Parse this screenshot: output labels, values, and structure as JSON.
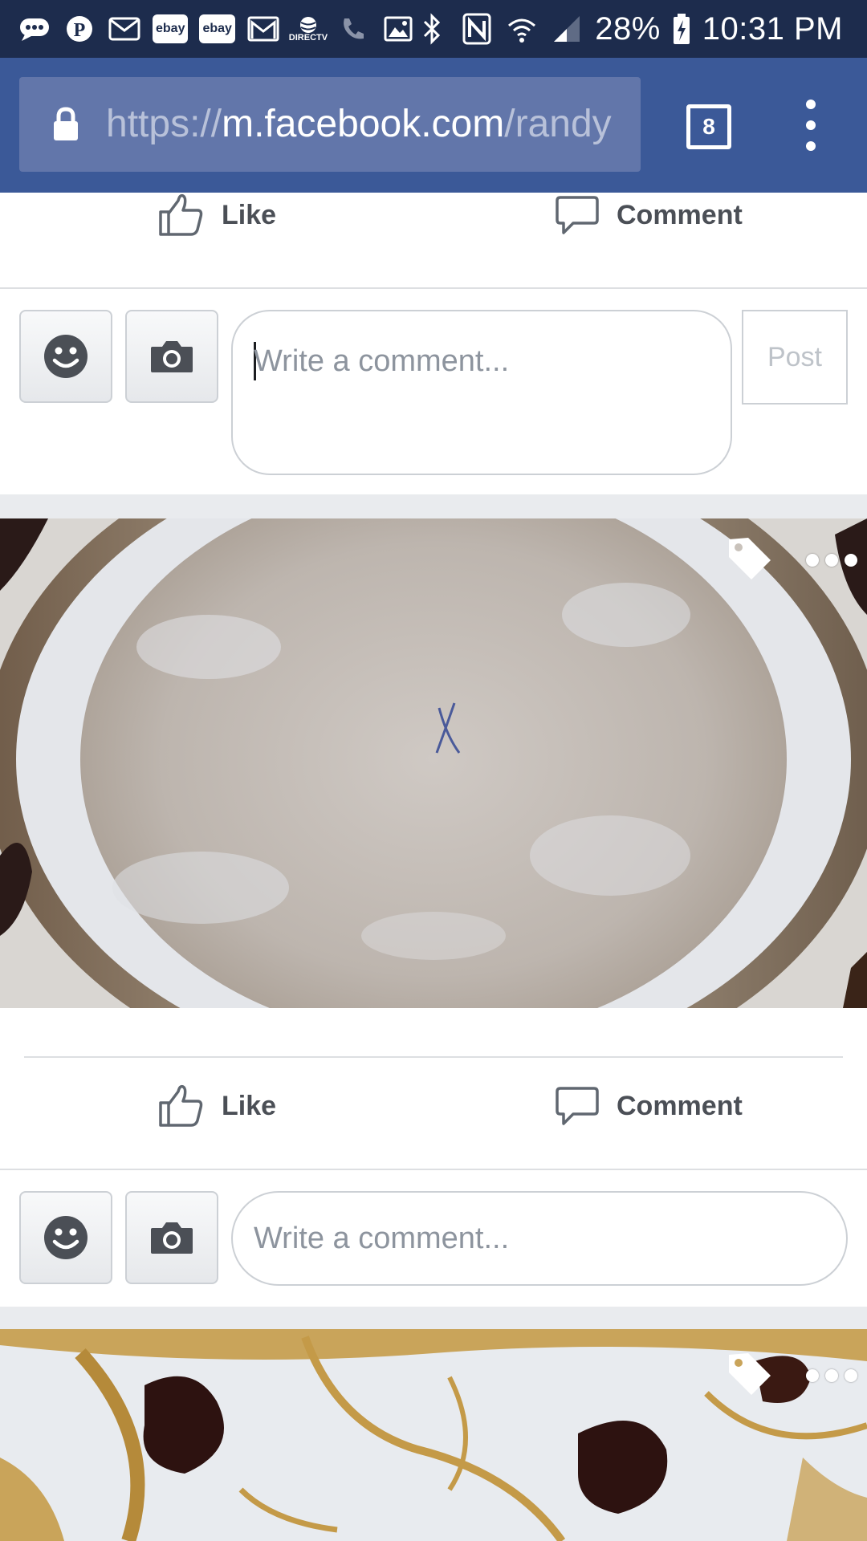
{
  "status_bar": {
    "carrier_label": "DIRECTV",
    "ebay_label_1": "ebay",
    "ebay_label_2": "ebay",
    "battery": "28%",
    "time": "10:31 PM"
  },
  "browser": {
    "url_scheme": "https://",
    "url_host": "m.facebook.com",
    "url_path": "/randy",
    "tab_count": "8"
  },
  "post1": {
    "like_label": "Like",
    "comment_label": "Comment",
    "comment_placeholder": "Write a comment...",
    "post_label": "Post"
  },
  "post2": {
    "like_label": "Like",
    "comment_label": "Comment",
    "comment_placeholder": "Write a comment..."
  },
  "photo1": {
    "mark": "X"
  },
  "colors": {
    "facebook_blue": "#3b5998",
    "status_bar": "#1d2c4d",
    "text_gray": "#4b4f56",
    "placeholder_gray": "#8d949e"
  }
}
